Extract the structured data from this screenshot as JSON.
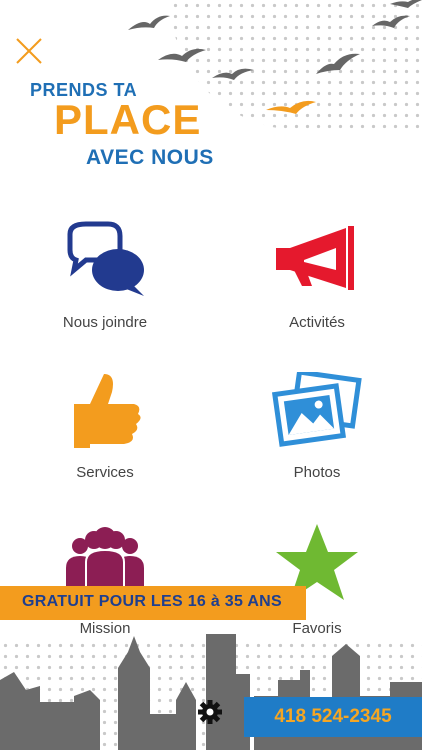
{
  "logo": {
    "line1": "PRENDS TA",
    "line2": "PLACE",
    "line3": "AVEC NOUS"
  },
  "menu": [
    {
      "label": "Nous joindre",
      "icon": "chat-bubbles-icon"
    },
    {
      "label": "Activités",
      "icon": "megaphone-icon"
    },
    {
      "label": "Services",
      "icon": "thumbs-up-icon"
    },
    {
      "label": "Photos",
      "icon": "photos-icon"
    },
    {
      "label": "Mission",
      "icon": "group-icon"
    },
    {
      "label": "Favoris",
      "icon": "star-icon"
    }
  ],
  "banner": {
    "text": "GRATUIT POUR LES 16 à 35 ANS"
  },
  "footer": {
    "phone": "418 524-2345",
    "settings_icon": "gear-icon"
  },
  "colors": {
    "logo_blue": "#1f6fb5",
    "logo_orange": "#f39c1e",
    "chat_blue": "#223a8f",
    "megaphone_red": "#e5192d",
    "thumb_orange": "#f39c1e",
    "photos_blue": "#2f8fd8",
    "group_maroon": "#8c1e54",
    "star_green": "#6fb932",
    "phone_bg": "#1f7cc7",
    "skyline_gray": "#6b6b6b"
  }
}
